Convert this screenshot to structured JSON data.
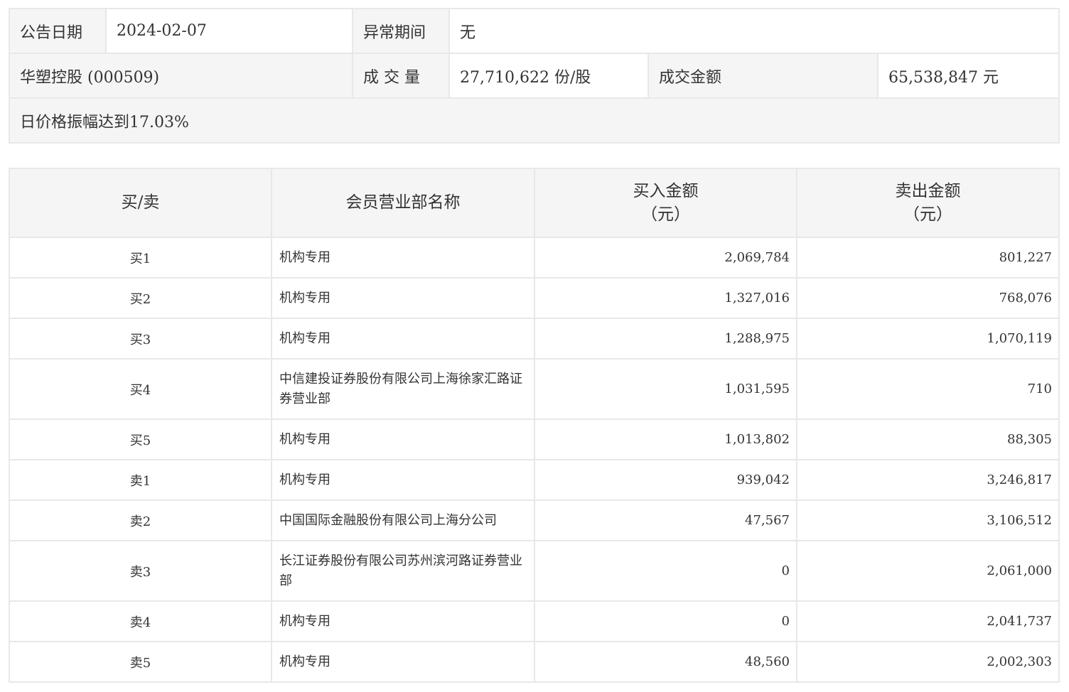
{
  "info": {
    "date_label": "公告日期",
    "date_value": "2024-02-07",
    "period_label": "异常期间",
    "period_value": "无",
    "stock": "华塑控股 (000509)",
    "volume_label": "成 交 量",
    "volume_value": "27,710,622 份/股",
    "amount_label": "成交金额",
    "amount_value": "65,538,847 元",
    "note": "日价格振幅达到17.03%"
  },
  "table": {
    "headers": {
      "side": "买/卖",
      "name": "会员营业部名称",
      "buy": "买入金额",
      "buy_unit": "（元）",
      "sell": "卖出金额",
      "sell_unit": "（元）"
    },
    "rows": [
      {
        "side": "买1",
        "name": "机构专用",
        "buy": "2,069,784",
        "sell": "801,227"
      },
      {
        "side": "买2",
        "name": "机构专用",
        "buy": "1,327,016",
        "sell": "768,076"
      },
      {
        "side": "买3",
        "name": "机构专用",
        "buy": "1,288,975",
        "sell": "1,070,119"
      },
      {
        "side": "买4",
        "name": "中信建投证券股份有限公司上海徐家汇路证券营业部",
        "buy": "1,031,595",
        "sell": "710"
      },
      {
        "side": "买5",
        "name": "机构专用",
        "buy": "1,013,802",
        "sell": "88,305"
      },
      {
        "side": "卖1",
        "name": "机构专用",
        "buy": "939,042",
        "sell": "3,246,817"
      },
      {
        "side": "卖2",
        "name": "中国国际金融股份有限公司上海分公司",
        "buy": "47,567",
        "sell": "3,106,512"
      },
      {
        "side": "卖3",
        "name": "长江证券股份有限公司苏州滨河路证券营业部",
        "buy": "0",
        "sell": "2,061,000"
      },
      {
        "side": "卖4",
        "name": "机构专用",
        "buy": "0",
        "sell": "2,041,737"
      },
      {
        "side": "卖5",
        "name": "机构专用",
        "buy": "48,560",
        "sell": "2,002,303"
      }
    ]
  }
}
